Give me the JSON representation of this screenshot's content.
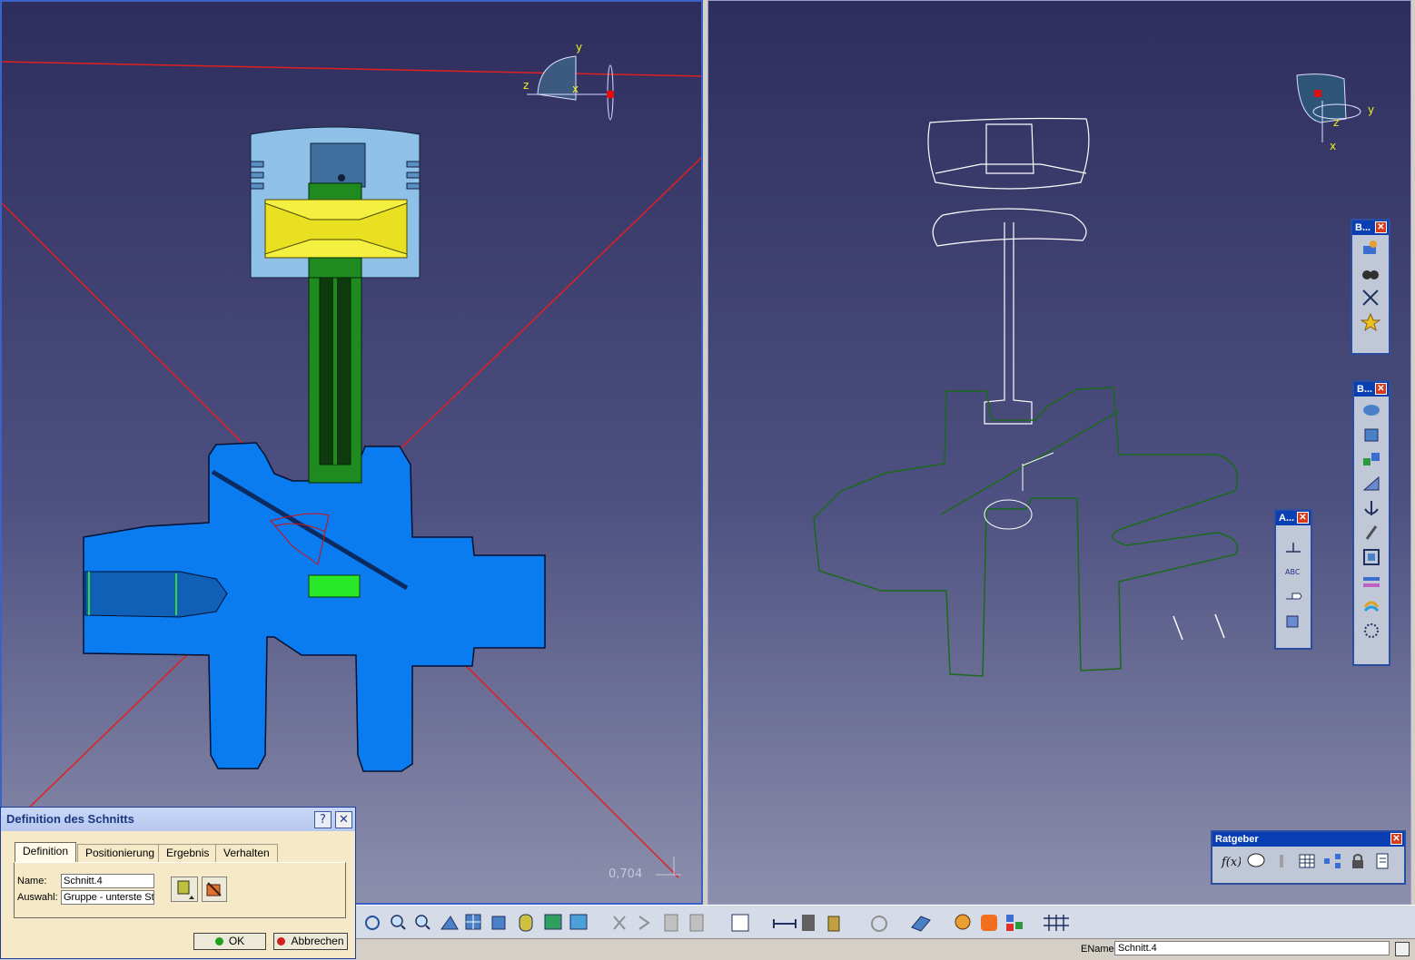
{
  "viewport_left": {
    "scale_value": "0,704",
    "axis_labels": [
      "y",
      "z",
      "x"
    ]
  },
  "viewport_right": {
    "axis_labels": [
      "y",
      "z",
      "x"
    ]
  },
  "toolbars": {
    "b1": {
      "title": "B...",
      "icons": [
        "view-manager-icon",
        "binoculars-icon",
        "fit-all-icon",
        "star-settings-icon"
      ]
    },
    "b2": {
      "title": "B...",
      "icons": [
        "section-icon",
        "box-icon",
        "part-group-icon",
        "measure-icon",
        "anchor-icon",
        "clip-icon",
        "view-box-icon",
        "link-icon",
        "rotate-icon",
        "explode-icon"
      ]
    },
    "a": {
      "title": "A...",
      "icons": [
        "dimension-icon",
        "abc-text-icon",
        "arrow-label-icon",
        "cube-annotation-icon"
      ]
    },
    "ratgeber": {
      "title": "Ratgeber",
      "icons": [
        "formula-icon",
        "comment-icon",
        "knowledge-icon",
        "table-icon",
        "tree-icon",
        "lock-icon",
        "checklist-icon"
      ]
    }
  },
  "dialog": {
    "title": "Definition des Schnitts",
    "help_label": "?",
    "close_label": "✕",
    "tabs": [
      "Definition",
      "Positionierung",
      "Ergebnis",
      "Verhalten"
    ],
    "active_tab": "Definition",
    "name_label": "Name:",
    "name_value": "Schnitt.4",
    "auswahl_label": "Auswahl:",
    "auswahl_value": "Gruppe - unterste St",
    "ok_label": "OK",
    "cancel_label": "Abbrechen"
  },
  "status": {
    "ename_label": "EName",
    "ename_value": "Schnitt.4"
  },
  "colors": {
    "crankshaft": "#0a7cf0",
    "piston": "#8fc0e8",
    "pin": "#f4f040",
    "rod": "#1f8a1f",
    "section_lines": "#e02020",
    "accent_title": "#0a3fb4"
  }
}
